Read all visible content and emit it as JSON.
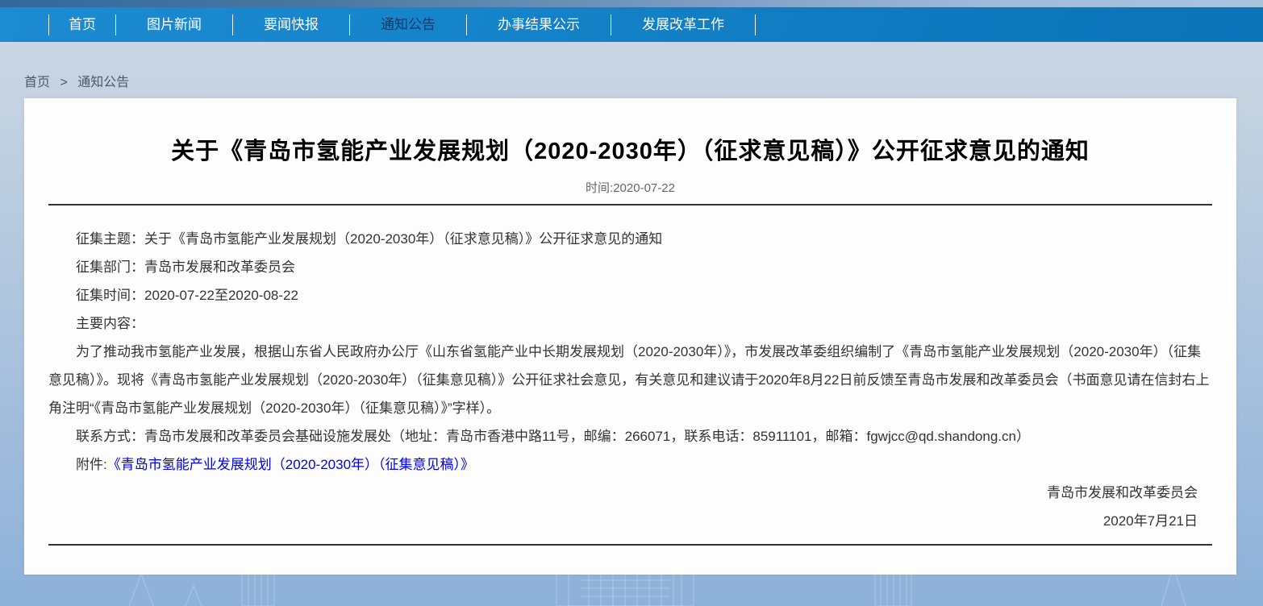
{
  "nav": {
    "items": [
      {
        "label": "首页",
        "active": false
      },
      {
        "label": "图片新闻",
        "active": false
      },
      {
        "label": "要闻快报",
        "active": false
      },
      {
        "label": "通知公告",
        "active": true
      },
      {
        "label": "办事结果公示",
        "active": false
      },
      {
        "label": "发展改革工作",
        "active": false
      }
    ]
  },
  "breadcrumb": {
    "home": "首页",
    "separator": ">",
    "current": "通知公告"
  },
  "article": {
    "title": "关于《青岛市氢能产业发展规划（2020-2030年）（征求意见稿）》公开征求意见的通知",
    "meta_time": "时间:2020-07-22",
    "fields": [
      "征集主题：关于《青岛市氢能产业发展规划（2020-2030年）（征求意见稿）》公开征求意见的通知",
      "征集部门：青岛市发展和改革委员会",
      "征集时间：2020-07-22至2020-08-22",
      "主要内容："
    ],
    "paragraph": "为了推动我市氢能产业发展，根据山东省人民政府办公厅《山东省氢能产业中长期发展规划（2020-2030年）》，市发展改革委组织编制了《青岛市氢能产业发展规划（2020-2030年）（征集意见稿）》。现将《青岛市氢能产业发展规划（2020-2030年）（征集意见稿）》公开征求社会意见，有关意见和建议请于2020年8月22日前反馈至青岛市发展和改革委员会（书面意见请在信封右上角注明“《青岛市氢能产业发展规划（2020-2030年）（征集意见稿）》”字样）。",
    "contact": "联系方式：青岛市发展和改革委员会基础设施发展处（地址：青岛市香港中路11号，邮编：266071，联系电话：85911101，邮箱：fgwjcc@qd.shandong.cn）",
    "attachment_label": "附件:",
    "attachment_link": "《青岛市氢能产业发展规划（2020-2030年）（征集意见稿）》",
    "signature_org": "青岛市发展和改革委员会",
    "signature_date": "2020年7月21日"
  },
  "colors": {
    "nav_background": "#1080c6",
    "nav_text": "#ffffff",
    "nav_active_text": "#0a3c6e",
    "page_background_top": "#cdd8e4",
    "page_background_bottom": "#8db1d9",
    "card_background": "#fdfdfd",
    "link_blue": "#0000e8",
    "body_text": "#333333",
    "meta_text": "#666666"
  }
}
